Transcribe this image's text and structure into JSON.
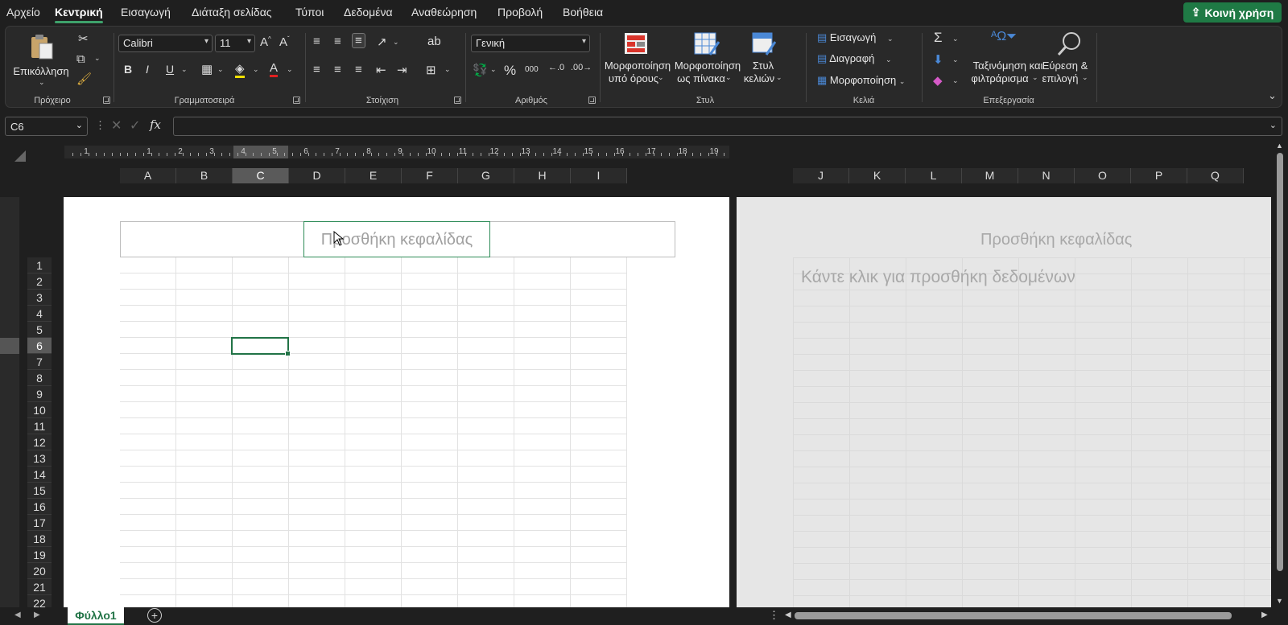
{
  "menu": {
    "items": [
      "Αρχείο",
      "Κεντρική",
      "Εισαγωγή",
      "Διάταξη σελίδας",
      "Τύποι",
      "Δεδομένα",
      "Αναθεώρηση",
      "Προβολή",
      "Βοήθεια"
    ],
    "active": "Κεντρική",
    "share_label": "Κοινή χρήση"
  },
  "ribbon": {
    "clipboard": {
      "paste_label": "Επικόλληση",
      "group_label": "Πρόχειρο"
    },
    "font": {
      "font_name": "Calibri",
      "font_size": "11",
      "group_label": "Γραμματοσειρά",
      "bold": "B",
      "italic": "I",
      "underline": "U"
    },
    "alignment": {
      "group_label": "Στοίχιση"
    },
    "number": {
      "format": "Γενική",
      "percent": "%",
      "thousands": "000",
      "group_label": "Αριθμός"
    },
    "styles": {
      "conditional_line1": "Μορφοποίηση",
      "conditional_line2": "υπό όρους",
      "table_line1": "Μορφοποίηση",
      "table_line2": "ως πίνακα",
      "cell_line1": "Στυλ",
      "cell_line2": "κελιών",
      "group_label": "Στυλ"
    },
    "cells": {
      "insert": "Εισαγωγή",
      "delete": "Διαγραφή",
      "format": "Μορφοποίηση",
      "group_label": "Κελιά"
    },
    "editing": {
      "sort_line1": "Ταξινόμηση και",
      "sort_line2": "φιλτράρισμα",
      "find_line1": "Εύρεση &",
      "find_line2": "επιλογή",
      "group_label": "Επεξεργασία"
    }
  },
  "formula_bar": {
    "name_box": "C6",
    "fx": "fx",
    "value": ""
  },
  "ruler": {
    "numbers": [
      "1",
      "1",
      "2",
      "3",
      "4",
      "5",
      "6",
      "7",
      "8",
      "9",
      "10",
      "11",
      "12",
      "13",
      "14",
      "15",
      "16",
      "17",
      "18",
      "19"
    ]
  },
  "columns": {
    "page1": [
      "A",
      "B",
      "C",
      "D",
      "E",
      "F",
      "G",
      "H",
      "I"
    ],
    "page2": [
      "J",
      "K",
      "L",
      "M",
      "N",
      "O",
      "P",
      "Q"
    ],
    "selected": "C"
  },
  "rows": {
    "labels": [
      "1",
      "2",
      "3",
      "4",
      "5",
      "6",
      "7",
      "8",
      "9",
      "10",
      "11",
      "12",
      "13",
      "14",
      "15",
      "16",
      "17",
      "18",
      "19",
      "20",
      "21",
      "22"
    ],
    "selected": "6"
  },
  "page": {
    "header_placeholder": "Προσθήκη κεφαλίδας",
    "page2_header": "Προσθήκη κεφαλίδας",
    "page2_click": "Κάντε κλικ για προσθήκη δεδομένων"
  },
  "sheets": {
    "active": "Φύλλο1"
  },
  "colors": {
    "accent": "#217346",
    "share": "#1f7a45"
  }
}
